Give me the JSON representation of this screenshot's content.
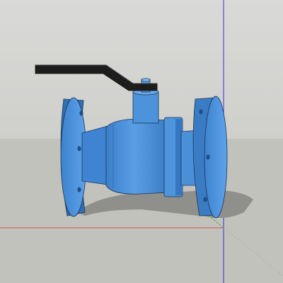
{
  "viewport": {
    "title": "",
    "colors": {
      "sky_top": "#d9d9d7",
      "sky_bottom": "#cfcfcc",
      "ground": "#c2c2bd",
      "shadow": "#8f8f8b",
      "valve_light": "#6ba8e8",
      "valve_mid": "#4a90d9",
      "valve_dark": "#2f6fb5",
      "valve_outline": "#1f3550",
      "handle": "#222222",
      "axis_blue": "#3b2fd9",
      "axis_red": "#d94a4a",
      "axis_green": "#3fae3f"
    }
  },
  "model": {
    "object": "ball-valve",
    "parts": [
      "left-flange",
      "body",
      "right-flange",
      "stem",
      "lever-handle"
    ]
  }
}
